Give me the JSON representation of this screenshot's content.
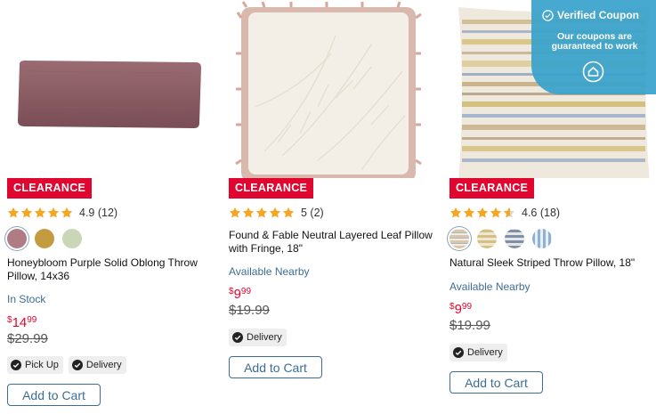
{
  "colors": {
    "accent": "#e0062f",
    "link": "#3d6d95",
    "star": "#f5a623",
    "coupon_bg": "#3aa3cc"
  },
  "coupon": {
    "title": "Verified Coupon",
    "subtitle": "Our coupons are guaranteed to work",
    "icon": "check-circle-icon",
    "logo_icon": "house-logo-icon"
  },
  "products": [
    {
      "badge": "CLEARANCE",
      "rating_stars": 4.9,
      "rating_text": "4.9 (12)",
      "swatches": [
        "#b07c84",
        "#c49b3f",
        "#c9d7b6"
      ],
      "title": "Honeybloom Purple Solid Oblong Throw Pillow, 14x36",
      "stock": "In Stock",
      "price": {
        "dollar": "$",
        "whole": "14",
        "cents": "99"
      },
      "old_price": "$29.99",
      "chips": [
        "Pick Up",
        "Delivery"
      ],
      "button": "Add to Cart"
    },
    {
      "badge": "CLEARANCE",
      "rating_stars": 5,
      "rating_text": "5 (2)",
      "swatches": [],
      "title": "Found & Fable Neutral Layered Leaf Pillow with Fringe, 18\"",
      "stock": "Available Nearby",
      "price": {
        "dollar": "$",
        "whole": "9",
        "cents": "99"
      },
      "old_price": "$19.99",
      "chips": [
        "Delivery"
      ],
      "button": "Add to Cart"
    },
    {
      "badge": "CLEARANCE",
      "rating_stars": 4.6,
      "rating_text": "4.6 (18)",
      "swatches": [
        "#d9c7a6",
        "#d4c082",
        "#9aa8bd",
        "#a9c0d8"
      ],
      "title": "Natural Sleek Striped Throw Pillow, 18\"",
      "stock": "Available Nearby",
      "price": {
        "dollar": "$",
        "whole": "9",
        "cents": "99"
      },
      "old_price": "$19.99",
      "chips": [
        "Delivery"
      ],
      "button": "Add to Cart"
    }
  ]
}
